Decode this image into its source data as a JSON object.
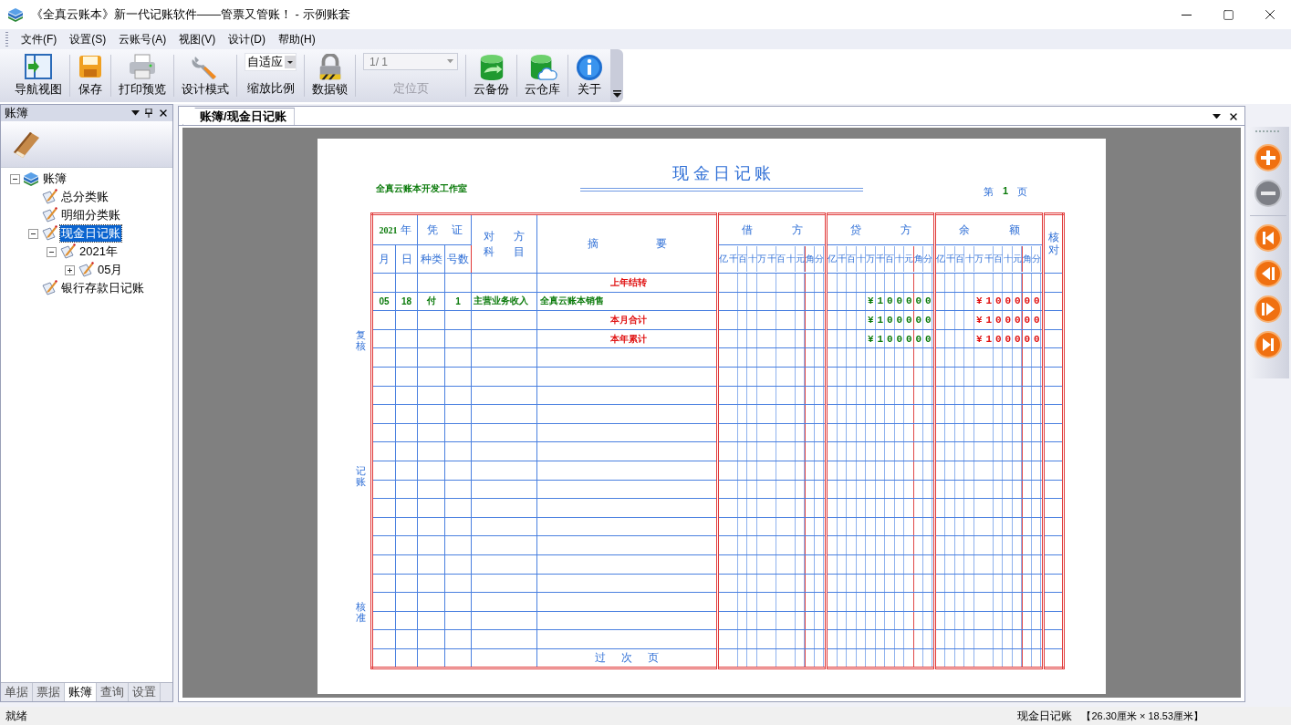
{
  "window": {
    "title": "《全真云账本》新一代记账软件——管票又管账！ - 示例账套"
  },
  "menu": [
    "文件(F)",
    "设置(S)",
    "云账号(A)",
    "视图(V)",
    "设计(D)",
    "帮助(H)"
  ],
  "toolbar": [
    {
      "kind": "button",
      "label": "导航视图"
    },
    {
      "kind": "button",
      "label": "保存"
    },
    {
      "kind": "button",
      "label": "打印预览"
    },
    {
      "kind": "button",
      "label": "设计模式"
    },
    {
      "kind": "dropdown",
      "value": "自适应",
      "label": "缩放比例"
    },
    {
      "kind": "button",
      "label": "数据锁"
    },
    {
      "kind": "page_field",
      "value": "1/ 1",
      "label": "定位页",
      "disabled": true
    },
    {
      "kind": "button",
      "label": "云备份"
    },
    {
      "kind": "button",
      "label": "云仓库"
    },
    {
      "kind": "button",
      "label": "关于"
    }
  ],
  "side_panel": {
    "title": "账簿",
    "tree": [
      {
        "label": "账簿",
        "expanded": true,
        "selected": false,
        "children": [
          {
            "label": "总分类账",
            "selected": false
          },
          {
            "label": "明细分类账",
            "selected": false
          },
          {
            "label": "现金日记账",
            "expanded": true,
            "selected": true,
            "children": [
              {
                "label": "2021年",
                "expanded": true,
                "selected": false,
                "children": [
                  {
                    "label": "05月",
                    "expanded": false,
                    "selected": false
                  }
                ]
              }
            ]
          },
          {
            "label": "银行存款日记账",
            "selected": false
          }
        ]
      }
    ],
    "tabs": [
      {
        "label": "单据",
        "selected": false
      },
      {
        "label": "票据",
        "selected": false
      },
      {
        "label": "账簿",
        "selected": true
      },
      {
        "label": "查询",
        "selected": false
      },
      {
        "label": "设置",
        "selected": false
      }
    ]
  },
  "document": {
    "tab": {
      "label": "账簿/现金日记账",
      "selected": true
    },
    "ledger": {
      "company": "全真云账本开发工作室",
      "title": "现 金 日 记 账",
      "page_prefix": "第",
      "page_number": "1",
      "page_suffix": "页",
      "side_labels": [
        "复核",
        "记账",
        "核准"
      ],
      "header": {
        "year": "2021",
        "year_unit": "年",
        "voucher": "凭 证",
        "month": "月",
        "day": "日",
        "voucher_kind": "种类",
        "voucher_number": "号数",
        "subject": [
          "对 方",
          "科 目"
        ],
        "summary": "摘 要",
        "check": "核对"
      },
      "amount_columns": [
        {
          "title": "借 方",
          "units": [
            "亿",
            "千",
            "百",
            "十",
            "万",
            "千",
            "百",
            "十",
            "元",
            "角",
            "分"
          ]
        },
        {
          "title": "贷 方",
          "units": [
            "亿",
            "千",
            "百",
            "十",
            "万",
            "千",
            "百",
            "十",
            "元",
            "角",
            "分"
          ]
        },
        {
          "title": "余 额",
          "units": [
            "亿",
            "千",
            "百",
            "十",
            "万",
            "千",
            "百",
            "十",
            "元",
            "角",
            "分"
          ]
        }
      ],
      "rows": [
        {
          "kind": "total",
          "summary": "上年结转"
        },
        {
          "kind": "entry",
          "month": "05",
          "day": "18",
          "voucher_kind": "付",
          "voucher_number": "1",
          "subject": "主营业务收入",
          "summary": "全真云账本销售",
          "credit": "¥100000",
          "balance": "¥100000"
        },
        {
          "kind": "total",
          "summary": "本月合计",
          "credit": "¥100000",
          "balance": "¥100000"
        },
        {
          "kind": "total",
          "summary": "本年累计",
          "credit": "¥100000",
          "balance": "¥100000"
        }
      ],
      "footer": "过 次 页"
    }
  },
  "nav_buttons": [
    {
      "disabled": false
    },
    {
      "disabled": true
    },
    {
      "disabled": false
    },
    {
      "disabled": false
    },
    {
      "disabled": false
    },
    {
      "disabled": false
    }
  ],
  "status_bar": {
    "message": "就绪",
    "document": "现金日记账",
    "size": "【26.30厘米 × 18.53厘米】"
  }
}
